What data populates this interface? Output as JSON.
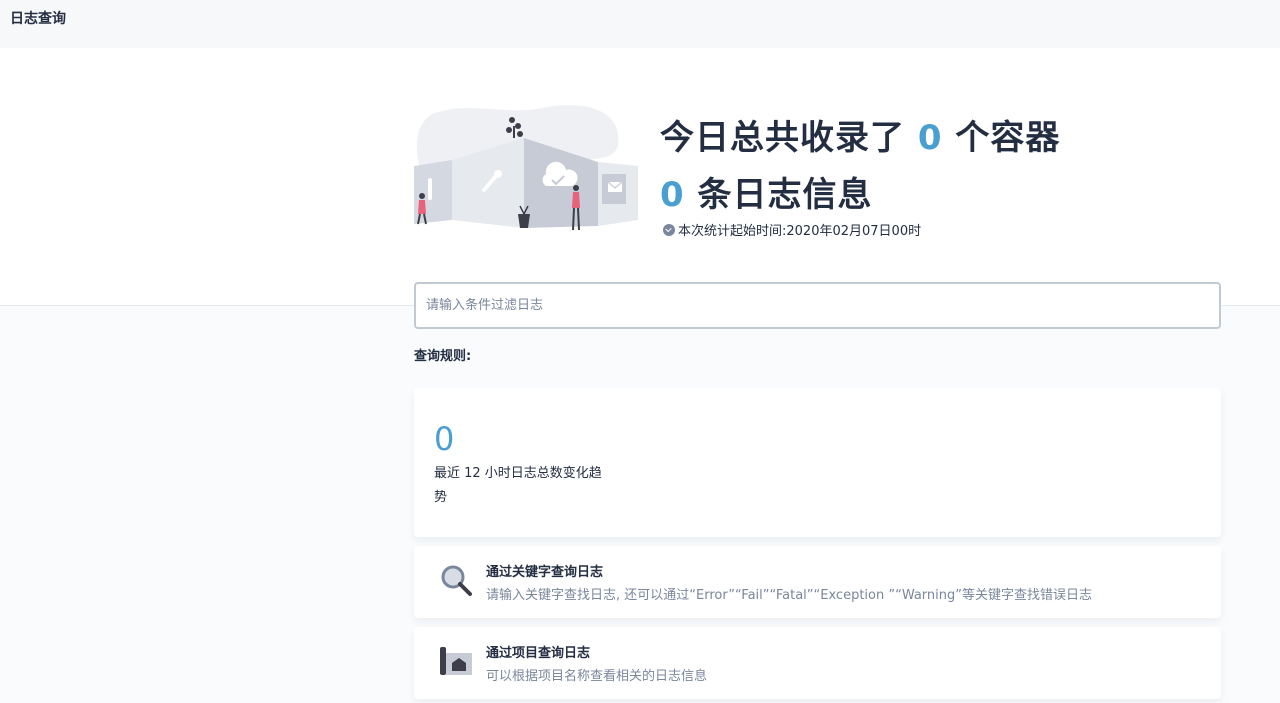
{
  "header": {
    "title": "日志查询"
  },
  "hero": {
    "line1_prefix": "今日总共收录了",
    "container_count": "0",
    "line1_suffix": "个容器",
    "log_count": "0",
    "line2_suffix": "条日志信息",
    "stat_start_label": "本次统计起始时间:2020年02月07日00时"
  },
  "search": {
    "placeholder": "请输入条件过滤日志",
    "value": ""
  },
  "rules": {
    "title": "查询规则:",
    "trend": {
      "value": "0",
      "label": "最近 12 小时日志总数变化趋势"
    },
    "items": [
      {
        "icon": "magnifier-icon",
        "title": "通过关键字查询日志",
        "desc": "请输入关键字查找日志, 还可以通过“Error”“Fail”“Fatal”“Exception ”“Warning”等关键字查找错误日志"
      },
      {
        "icon": "project-icon",
        "title": "通过项目查询日志",
        "desc": "可以根据项目名称查看相关的日志信息"
      }
    ]
  },
  "colors": {
    "accent": "#4a9fd1",
    "text_primary": "#242e42",
    "text_secondary": "#79879c",
    "border": "#c1c9d1"
  }
}
